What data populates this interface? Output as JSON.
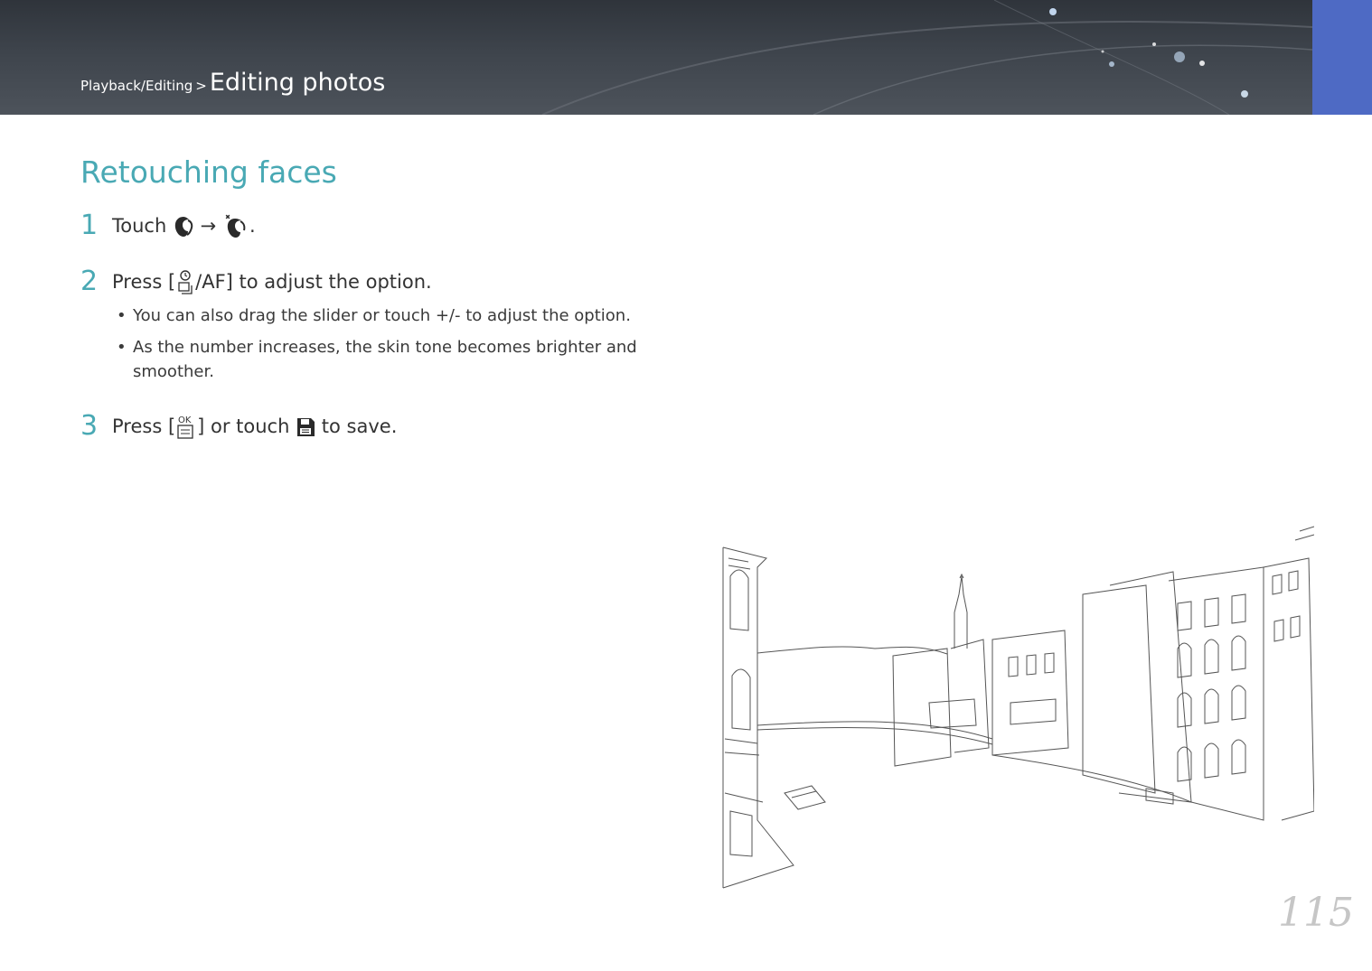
{
  "header": {
    "breadcrumb_parent": "Playback/Editing",
    "separator": ">",
    "breadcrumb_current": "Editing photos"
  },
  "section": {
    "title": "Retouching faces"
  },
  "steps": [
    {
      "num": "1",
      "pre": "Touch",
      "arrow": "→",
      "post": "."
    },
    {
      "num": "2",
      "pre": "Press [",
      "mid": "/",
      "af": "AF",
      "post": "] to adjust the option."
    },
    {
      "num": "3",
      "pre": "Press [",
      "mid": "] or touch",
      "post": "to save."
    }
  ],
  "bullets": [
    "You can also drag the slider or touch +/- to adjust the option.",
    "As the number increases, the skin tone becomes brighter and smoother."
  ],
  "bullet_marker": "•",
  "page": {
    "number": "115"
  },
  "icons": {
    "retouch": "face-retouch-icon",
    "face_retouch_option": "face-retouch-option-icon",
    "timer_drive": "timer-drive-icon",
    "ok_menu": "ok-menu-icon",
    "save": "save-icon"
  },
  "colors": {
    "accent": "#49a9b4",
    "header_bg": "#3e444c",
    "tab": "#4e6ac4",
    "page_number": "#c6c6c6"
  }
}
